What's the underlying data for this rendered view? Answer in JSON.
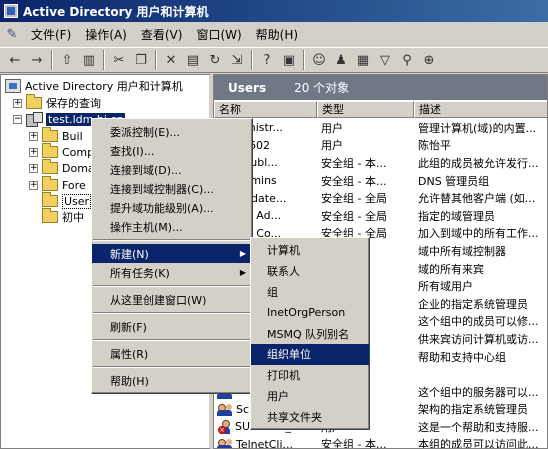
{
  "window": {
    "title": "Active Directory 用户和计算机"
  },
  "menubar": {
    "items": [
      "文件(F)",
      "操作(A)",
      "查看(V)",
      "窗口(W)",
      "帮助(H)"
    ]
  },
  "toolbar": {
    "icons": [
      "back-arrow-icon",
      "forward-arrow-icon",
      "up-folder-icon",
      "show-hide-tree-icon",
      "cut-icon",
      "copy-icon",
      "delete-icon",
      "properties-icon",
      "refresh-icon",
      "export-icon",
      "help-icon",
      "console-icon",
      "new-user-icon",
      "new-group-icon",
      "new-ou-icon",
      "filter-icon",
      "find-icon",
      "add-to-group-icon"
    ]
  },
  "tree": {
    "root": "Active Directory 用户和计算机",
    "saved_queries": "保存的查询",
    "domain": "test.ldm.hj.cn",
    "children": [
      "Buil",
      "Comp",
      "Doma",
      "Fore",
      "User",
      "初中"
    ]
  },
  "list": {
    "container": "Users",
    "object_count": "20 个对象",
    "columns": [
      "名称",
      "类型",
      "描述"
    ],
    "rows": [
      {
        "name": "ministr...",
        "type": "用户",
        "desc": "管理计算机(域)的内置...",
        "icon": "user"
      },
      {
        "name": "10602",
        "type": "用户",
        "desc": "陈怡平",
        "icon": "user"
      },
      {
        "name": "t Publ...",
        "type": "安全组 - 本...",
        "desc": "此组的成员被允许发行...",
        "icon": "group"
      },
      {
        "name": "Admins",
        "type": "安全组 - 本...",
        "desc": "DNS 管理员组",
        "icon": "group"
      },
      {
        "name": "Update...",
        "type": "安全组 - 全局",
        "desc": "允许替其他客户端 (如...",
        "icon": "group"
      },
      {
        "name": "ain Ad...",
        "type": "安全组 - 全局",
        "desc": "指定的域管理员",
        "icon": "group"
      },
      {
        "name": "ain Co...",
        "type": "安全组 - 全局",
        "desc": "加入到域中的所有工作...",
        "icon": "group"
      },
      {
        "name": "",
        "type": "全局",
        "desc": "域中所有域控制器",
        "icon": "group"
      },
      {
        "name": "",
        "type": "全局",
        "desc": "域的所有来宾",
        "icon": "group"
      },
      {
        "name": "",
        "type": "全局",
        "desc": "所有域用户",
        "icon": "group"
      },
      {
        "name": "",
        "type": "全局",
        "desc": "企业的指定系统管理员",
        "icon": "group"
      },
      {
        "name": "",
        "type": "全局",
        "desc": "这个组中的成员可以修...",
        "icon": "group"
      },
      {
        "name": "",
        "type": "",
        "desc": "供来宾访问计算机或访...",
        "icon": "user"
      },
      {
        "name": "",
        "type": "",
        "desc": "帮助和支持中心组",
        "icon": "group"
      },
      {
        "name": "",
        "type": "",
        "desc": "",
        "icon": "group"
      },
      {
        "name": "",
        "type": "本...",
        "desc": "这个组中的服务器可以...",
        "icon": "group"
      },
      {
        "name": "Sc",
        "type": "全局",
        "desc": "架构的指定系统管理员",
        "icon": "group"
      },
      {
        "name": "SUPPORT_3...",
        "type": "用户",
        "desc": "这是一个帮助和支持服...",
        "icon": "user-disabled"
      },
      {
        "name": "TelnetCli...",
        "type": "安全组 - 本...",
        "desc": "本组的成员可以访问此...",
        "icon": "group"
      },
      {
        "name": "c110601",
        "type": "用户",
        "desc": "苏勤",
        "icon": "user"
      }
    ]
  },
  "context_menu": {
    "items": [
      {
        "label": "委派控制(E)...",
        "type": "item"
      },
      {
        "label": "查找(I)...",
        "type": "item"
      },
      {
        "label": "连接到域(D)...",
        "type": "item"
      },
      {
        "label": "连接到域控制器(C)...",
        "type": "item"
      },
      {
        "label": "提升域功能级别(A)...",
        "type": "item"
      },
      {
        "label": "操作主机(M)...",
        "type": "item"
      },
      {
        "type": "sep"
      },
      {
        "label": "新建(N)",
        "type": "submenu",
        "active": true
      },
      {
        "label": "所有任务(K)",
        "type": "submenu"
      },
      {
        "type": "sep"
      },
      {
        "label": "从这里创建窗口(W)",
        "type": "item"
      },
      {
        "type": "sep"
      },
      {
        "label": "刷新(F)",
        "type": "item"
      },
      {
        "type": "sep"
      },
      {
        "label": "属性(R)",
        "type": "item"
      },
      {
        "type": "sep"
      },
      {
        "label": "帮助(H)",
        "type": "item"
      }
    ]
  },
  "submenu_new": {
    "items": [
      "计算机",
      "联系人",
      "组",
      "InetOrgPerson",
      "MSMQ 队列别名",
      "组织单位",
      "打印机",
      "用户",
      "共享文件夹"
    ],
    "active_index": 5
  },
  "colors": {
    "selection": "#0a246a",
    "titlebar_start": "#0a246a",
    "titlebar_end": "#3a6ea5"
  }
}
